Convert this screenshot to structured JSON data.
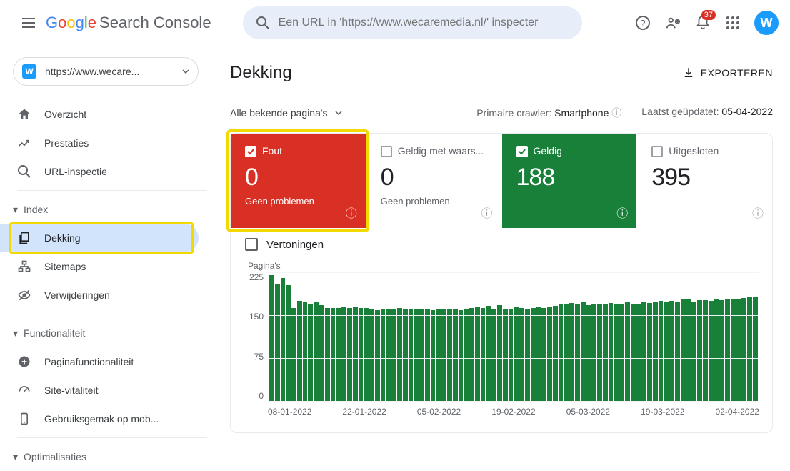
{
  "header": {
    "product": {
      "google": "Google",
      "name": "Search Console"
    },
    "search_placeholder": "Een URL in 'https://www.wecaremedia.nl/' inspecter",
    "notification_count": "37",
    "avatar_letter": "W"
  },
  "property": {
    "label": "https://www.wecare..."
  },
  "sidebar": {
    "items_top": [
      {
        "label": "Overzicht"
      },
      {
        "label": "Prestaties"
      },
      {
        "label": "URL-inspectie"
      }
    ],
    "section_index": "Index",
    "items_index": [
      {
        "label": "Dekking"
      },
      {
        "label": "Sitemaps"
      },
      {
        "label": "Verwijderingen"
      }
    ],
    "section_func": "Functionaliteit",
    "items_func": [
      {
        "label": "Paginafunctionaliteit"
      },
      {
        "label": "Site-vitaliteit"
      },
      {
        "label": "Gebruiksgemak op mob..."
      }
    ],
    "section_opt": "Optimalisaties"
  },
  "page": {
    "title": "Dekking",
    "export": "EXPORTEREN",
    "filter": "Alle bekende pagina's",
    "crawler_label": "Primaire crawler:",
    "crawler_value": "Smartphone",
    "updated_label": "Laatst geüpdatet:",
    "updated_value": "05-04-2022"
  },
  "tiles": [
    {
      "label": "Fout",
      "value": "0",
      "sub": "Geen problemen",
      "checked": true
    },
    {
      "label": "Geldig met waars...",
      "value": "0",
      "sub": "Geen problemen",
      "checked": false
    },
    {
      "label": "Geldig",
      "value": "188",
      "sub": "",
      "checked": true
    },
    {
      "label": "Uitgesloten",
      "value": "395",
      "sub": "",
      "checked": false
    }
  ],
  "impressions_label": "Vertoningen",
  "chart_data": {
    "type": "bar",
    "title": "",
    "ylabel": "Pagina's",
    "ylim": [
      0,
      225
    ],
    "x_ticks": [
      "08-01-2022",
      "22-01-2022",
      "05-02-2022",
      "19-02-2022",
      "05-03-2022",
      "19-03-2022",
      "02-04-2022"
    ],
    "y_ticks": [
      225,
      150,
      75,
      0
    ],
    "values": [
      220,
      205,
      215,
      202,
      163,
      175,
      174,
      170,
      172,
      168,
      163,
      162,
      163,
      165,
      162,
      164,
      163,
      162,
      160,
      159,
      160,
      160,
      161,
      162,
      160,
      161,
      160,
      160,
      161,
      159,
      160,
      161,
      160,
      161,
      159,
      161,
      162,
      164,
      163,
      166,
      160,
      168,
      160,
      160,
      165,
      163,
      161,
      163,
      164,
      162,
      165,
      166,
      169,
      170,
      171,
      170,
      172,
      168,
      169,
      170,
      170,
      171,
      169,
      170,
      172,
      170,
      169,
      172,
      171,
      172,
      175,
      172,
      175,
      173,
      177,
      178,
      174,
      176,
      176,
      175,
      177,
      176,
      177,
      178,
      178,
      180,
      181,
      182
    ]
  }
}
